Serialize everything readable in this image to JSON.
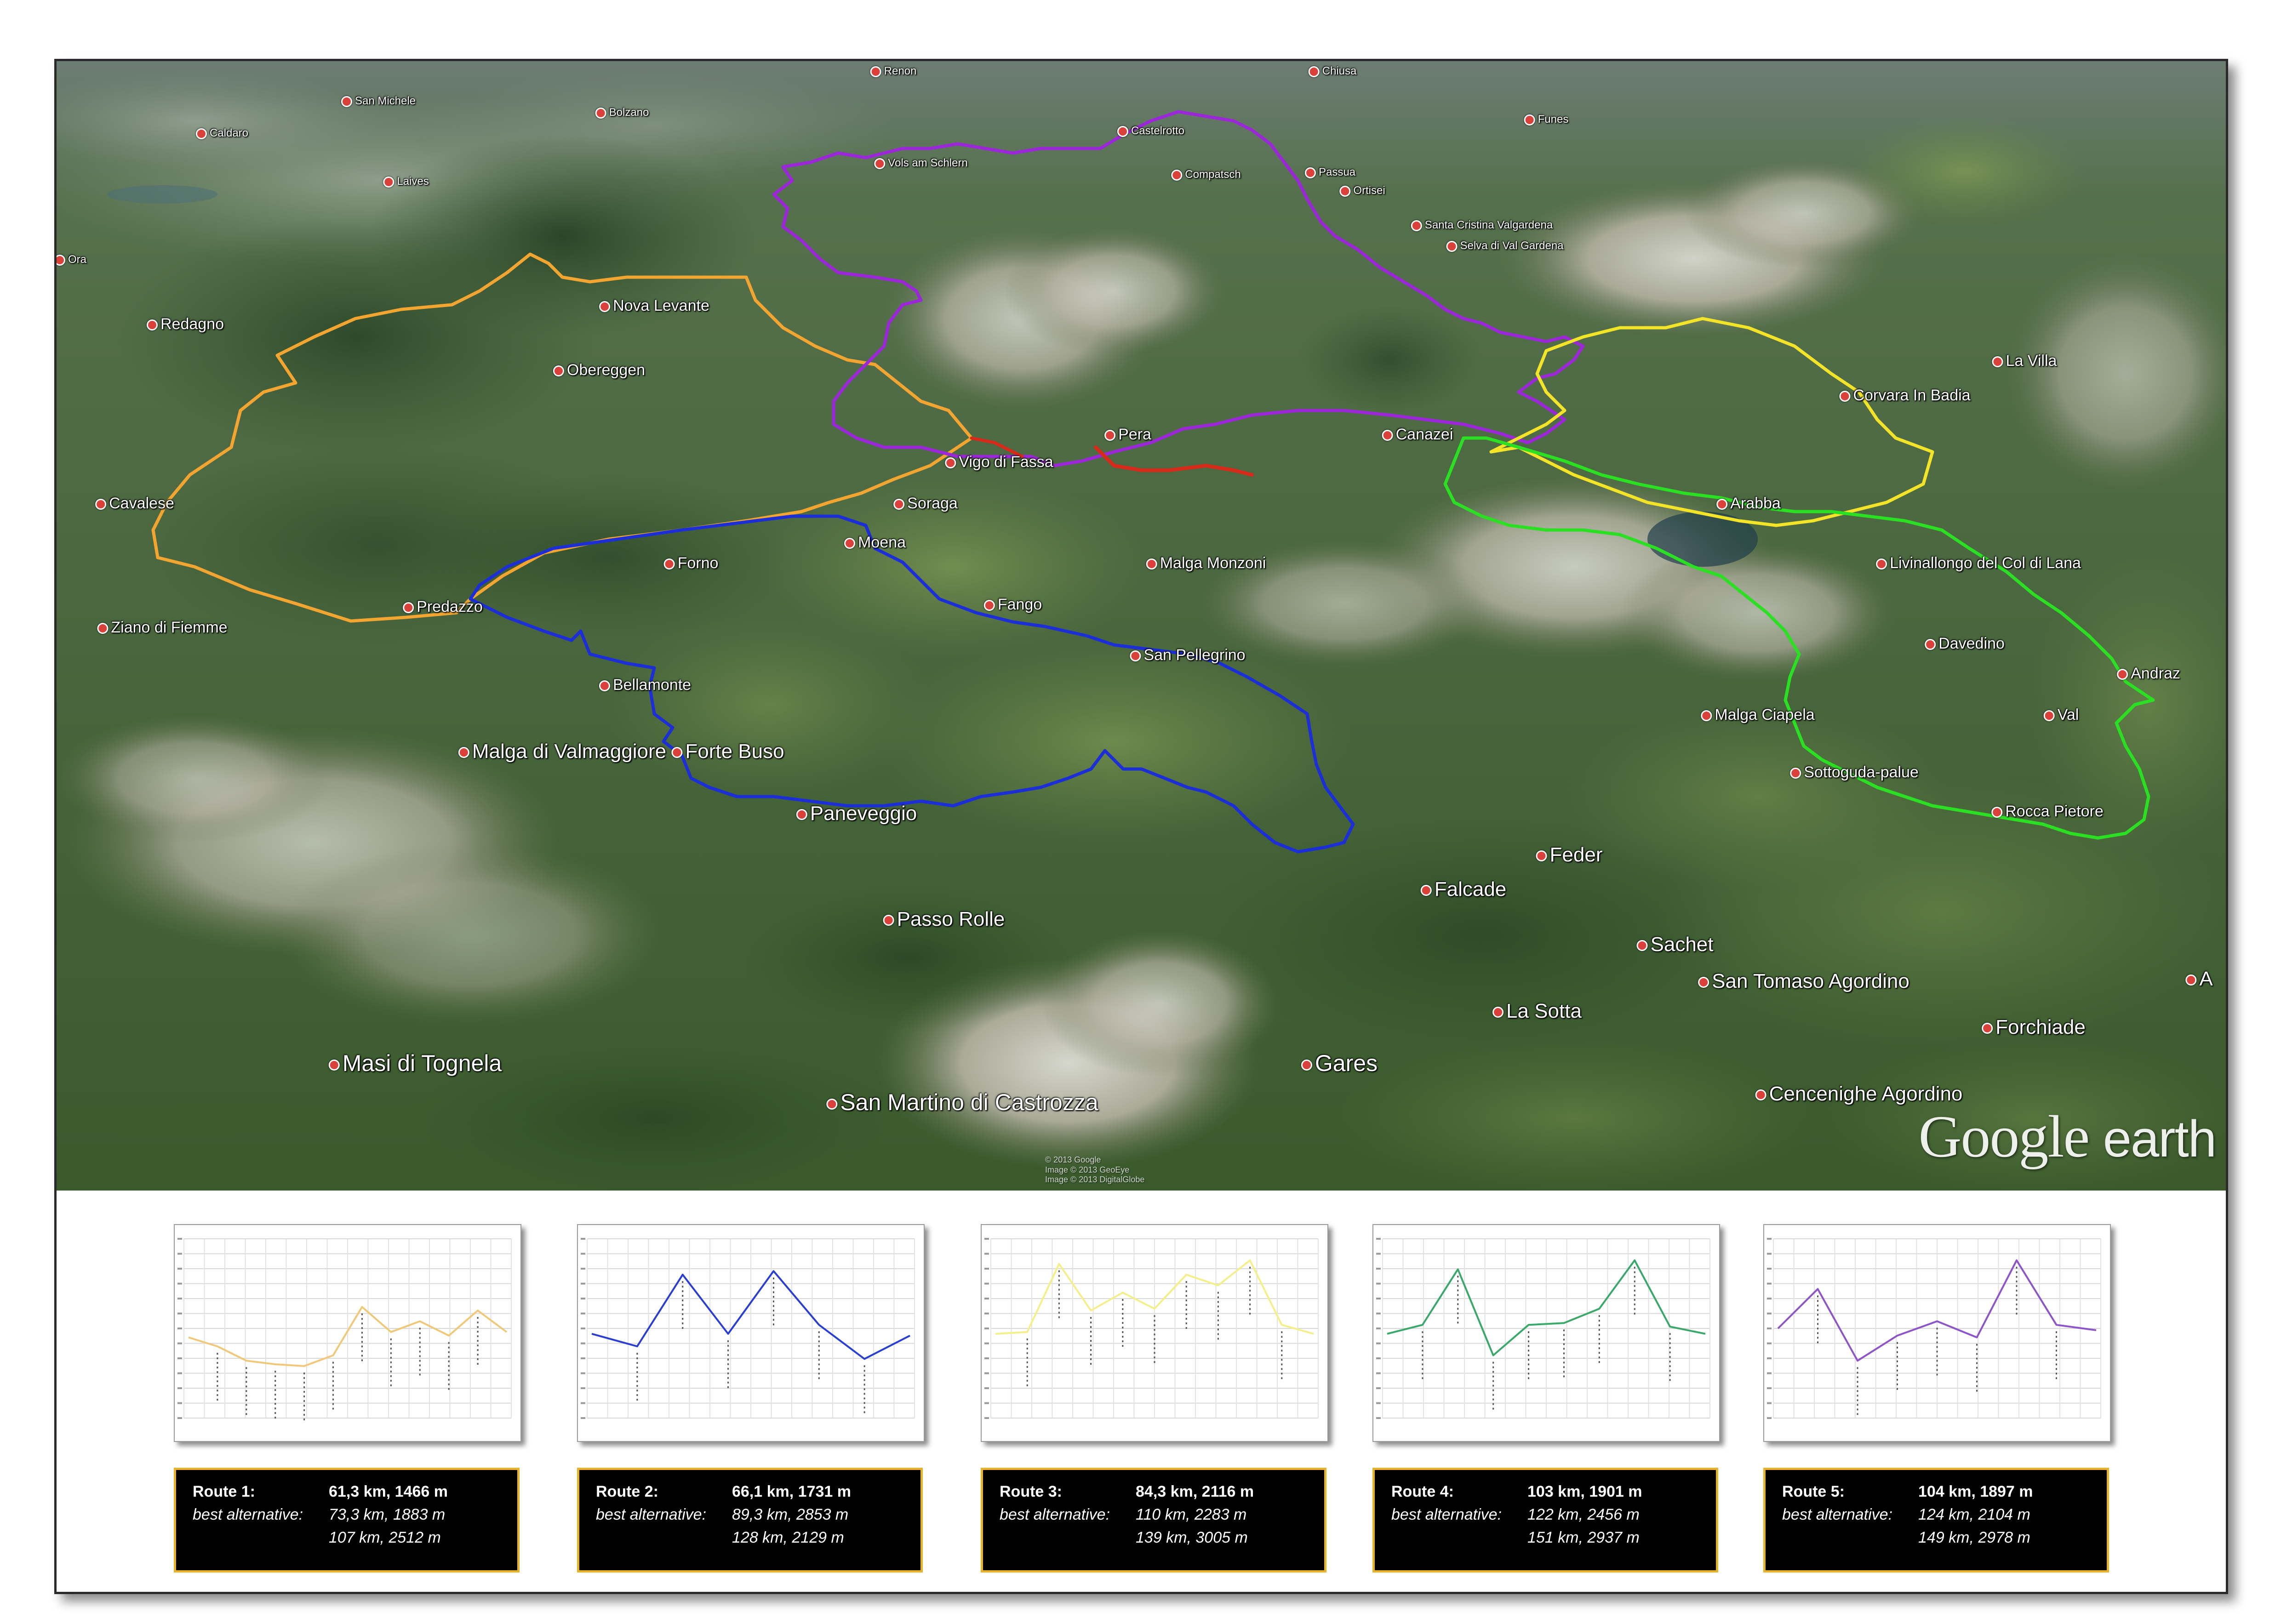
{
  "map": {
    "places": [
      {
        "name": "Renon",
        "size": "s"
      },
      {
        "name": "Chiusa",
        "size": "s"
      },
      {
        "name": "San Michele",
        "size": "s"
      },
      {
        "name": "Bolzano",
        "size": "s"
      },
      {
        "name": "Funes",
        "size": "s"
      },
      {
        "name": "Caldaro",
        "size": "s"
      },
      {
        "name": "Laives",
        "size": "s"
      },
      {
        "name": "Vols am Schlern",
        "size": "s"
      },
      {
        "name": "Castelrotto",
        "size": "s"
      },
      {
        "name": "Compatsch",
        "size": "s"
      },
      {
        "name": "Passua",
        "size": "s"
      },
      {
        "name": "Ortisei",
        "size": "s"
      },
      {
        "name": "Santa Cristina Valgardena",
        "size": "s"
      },
      {
        "name": "Selva di Val Gardena",
        "size": "s"
      },
      {
        "name": "Ora",
        "size": "s"
      },
      {
        "name": "Redagno",
        "size": "m"
      },
      {
        "name": "Nova Levante",
        "size": "m"
      },
      {
        "name": "Obereggen",
        "size": "m"
      },
      {
        "name": "La Villa",
        "size": "m"
      },
      {
        "name": "Corvara In Badia",
        "size": "m"
      },
      {
        "name": "Cavalese",
        "size": "m"
      },
      {
        "name": "Vigo di Fassa",
        "size": "m"
      },
      {
        "name": "Pera",
        "size": "m"
      },
      {
        "name": "Canazei",
        "size": "m"
      },
      {
        "name": "Soraga",
        "size": "m"
      },
      {
        "name": "Arabba",
        "size": "m"
      },
      {
        "name": "Moena",
        "size": "m"
      },
      {
        "name": "Forno",
        "size": "m"
      },
      {
        "name": "Malga Monzoni",
        "size": "m"
      },
      {
        "name": "Livinallongo del Col di Lana",
        "size": "m"
      },
      {
        "name": "Ziano di Fiemme",
        "size": "m"
      },
      {
        "name": "Predazzo",
        "size": "m"
      },
      {
        "name": "Fango",
        "size": "m"
      },
      {
        "name": "Davedino",
        "size": "m"
      },
      {
        "name": "San Pellegrino",
        "size": "m"
      },
      {
        "name": "Andraz",
        "size": "m"
      },
      {
        "name": "Bellamonte",
        "size": "m"
      },
      {
        "name": "Malga Ciapela",
        "size": "m"
      },
      {
        "name": "Val",
        "size": "m"
      },
      {
        "name": "Forte Buso",
        "size": "l"
      },
      {
        "name": "Malga di Valmaggiore",
        "size": "l"
      },
      {
        "name": "Sottoguda-palue",
        "size": "m"
      },
      {
        "name": "Paneveggio",
        "size": "l"
      },
      {
        "name": "Rocca Pietore",
        "size": "m"
      },
      {
        "name": "Feder",
        "size": "l"
      },
      {
        "name": "Falcade",
        "size": "l"
      },
      {
        "name": "Passo Rolle",
        "size": "l"
      },
      {
        "name": "Sachet",
        "size": "l"
      },
      {
        "name": "San Tomaso Agordino",
        "size": "l"
      },
      {
        "name": "La Sotta",
        "size": "l"
      },
      {
        "name": "Forchiade",
        "size": "l"
      },
      {
        "name": "Masi di Tognela",
        "size": "xl"
      },
      {
        "name": "Gares",
        "size": "xl"
      },
      {
        "name": "San Martino di Castrozza",
        "size": "xl"
      },
      {
        "name": "Cencenighe Agordino",
        "size": "l"
      },
      {
        "name": "A",
        "size": "l"
      }
    ],
    "routes": [
      {
        "id": "route-1",
        "color": "#f2a531"
      },
      {
        "id": "route-2",
        "color": "#1c2fd6"
      },
      {
        "id": "route-3",
        "color": "#f3e329"
      },
      {
        "id": "route-4",
        "color": "#2be022"
      },
      {
        "id": "route-5",
        "color": "#9b27d8"
      },
      {
        "id": "route-red",
        "color": "#d62a1a"
      }
    ],
    "logo": {
      "google": "Google",
      "earth": "earth"
    },
    "credits": "© 2013 Google\nImage © 2013 GeoEye\nImage © 2013 DigitalGlobe"
  },
  "panels": [
    {
      "route_label": "Route 1:",
      "summary": "61,3 km, 1466 m",
      "alt_label": "best alternative:",
      "alt1": "73,3 km, 1883 m",
      "alt2": "107 km, 2512 m",
      "color": "#f0c87a"
    },
    {
      "route_label": "Route 2:",
      "summary": "66,1 km, 1731 m",
      "alt_label": "best alternative:",
      "alt1": "89,3 km, 2853 m",
      "alt2": "128 km,  2129 m",
      "color": "#2a3fd0"
    },
    {
      "route_label": "Route 3:",
      "summary": "84,3 km, 2116 m",
      "alt_label": "best alternative:",
      "alt1": "110 km, 2283 m",
      "alt2": "139 km, 3005 m",
      "color": "#f4ef8a"
    },
    {
      "route_label": "Route 4:",
      "summary": "103 km, 1901 m",
      "alt_label": "best alternative:",
      "alt1": "122 km, 2456 m",
      "alt2": "151 km, 2937 m",
      "color": "#3aa86a"
    },
    {
      "route_label": "Route 5:",
      "summary": "104 km, 1897 m",
      "alt_label": "best alternative:",
      "alt1": "124 km, 2104 m",
      "alt2": "149 km, 2978 m",
      "color": "#8e55c8"
    }
  ],
  "chart_data": [
    {
      "type": "line",
      "series": [
        {
          "values": [
            0.45,
            0.4,
            0.32,
            0.3,
            0.29,
            0.35,
            0.62,
            0.48,
            0.54,
            0.46,
            0.6,
            0.48
          ]
        }
      ]
    },
    {
      "type": "line",
      "series": [
        {
          "values": [
            0.47,
            0.4,
            0.8,
            0.47,
            0.82,
            0.52,
            0.33,
            0.46
          ]
        }
      ]
    },
    {
      "type": "line",
      "series": [
        {
          "values": [
            0.47,
            0.48,
            0.86,
            0.6,
            0.7,
            0.61,
            0.8,
            0.74,
            0.88,
            0.52,
            0.47
          ]
        }
      ]
    },
    {
      "type": "line",
      "series": [
        {
          "values": [
            0.47,
            0.52,
            0.83,
            0.35,
            0.52,
            0.53,
            0.61,
            0.88,
            0.51,
            0.47
          ]
        }
      ]
    },
    {
      "type": "line",
      "series": [
        {
          "values": [
            0.5,
            0.72,
            0.32,
            0.46,
            0.54,
            0.45,
            0.88,
            0.52,
            0.49
          ]
        }
      ]
    }
  ]
}
